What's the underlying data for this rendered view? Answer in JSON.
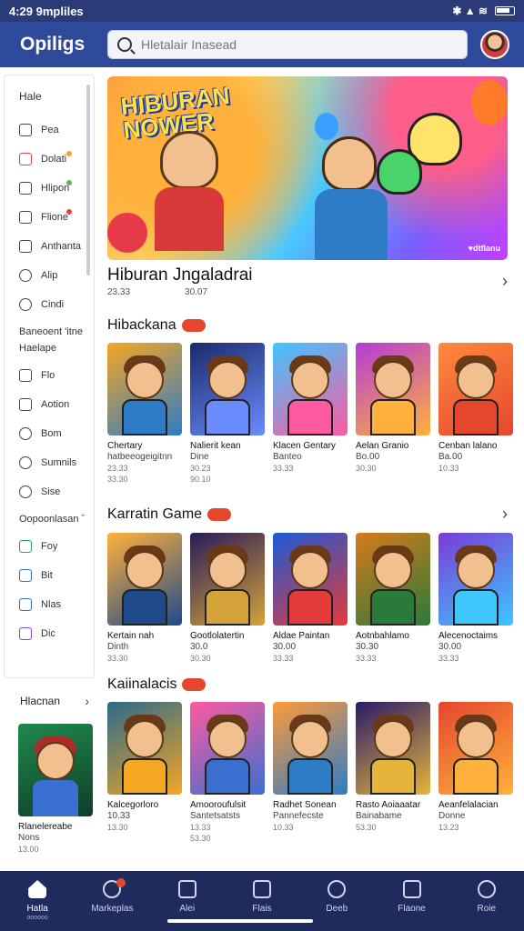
{
  "status": {
    "time": "4:29 9mpliles",
    "icons": "✱ ▲ ≋"
  },
  "header": {
    "title": "Opiligs",
    "search_placeholder": "Hletalair Inasead"
  },
  "sidebar": {
    "heading": "Hale",
    "items_top": [
      {
        "label": "Pea",
        "icon": "store-icon",
        "tone": ""
      },
      {
        "label": "Dolati",
        "icon": "calendar-icon",
        "tone": "red",
        "dot": "#f2a43a"
      },
      {
        "label": "Hlipon",
        "icon": "house-icon",
        "tone": "",
        "dot": "#58b65a"
      },
      {
        "label": "Flione",
        "icon": "book-icon",
        "tone": "",
        "dot": "#e5462e"
      },
      {
        "label": "Anthanta",
        "icon": "bookmark-icon",
        "tone": ""
      },
      {
        "label": "Alip",
        "icon": "gear-icon",
        "tone": "round"
      },
      {
        "label": "Cindi",
        "icon": "clock-icon",
        "tone": "round"
      }
    ],
    "section1": "Baneoent 'itne",
    "section1b": "Haelape",
    "items_mid": [
      {
        "label": "Flo",
        "icon": "pen-icon",
        "tone": ""
      },
      {
        "label": "Aotion",
        "icon": "window-icon",
        "tone": ""
      },
      {
        "label": "Bom",
        "icon": "bell-icon",
        "tone": "round"
      },
      {
        "label": "Sumnils",
        "icon": "globe-icon",
        "tone": "round"
      },
      {
        "label": "Sise",
        "icon": "chat-icon",
        "tone": "round"
      }
    ],
    "section2": "Oopoonlasan ˇ",
    "items_bot": [
      {
        "label": "Foy",
        "icon": "gamepad-icon",
        "tone": "green"
      },
      {
        "label": "Bit",
        "icon": "grid-icon",
        "tone": "blue"
      },
      {
        "label": "Nlas",
        "icon": "pin-icon",
        "tone": "blue"
      },
      {
        "label": "Dic",
        "icon": "doc-icon",
        "tone": "purple"
      }
    ],
    "footer": "Hlacnan"
  },
  "banner": {
    "title_line1": "HIBURAN",
    "title_line2": "NOWER",
    "badge": "♥dtflanu"
  },
  "featured": {
    "title": "Hiburan Jngaladrai",
    "meta1": "23.33",
    "meta2": "30.07"
  },
  "sections": [
    {
      "title": "Hibackana",
      "cards": [
        {
          "title": "Chertary",
          "sub": "hatbeeogeigitnn",
          "price1": "23.33",
          "price2": "33.30"
        },
        {
          "title": "Nalierit kean",
          "sub": "Dine",
          "price1": "30.23",
          "price2": "90.10"
        },
        {
          "title": "Klacen Gentary",
          "sub": "Banteo",
          "price1": "33.33",
          "price2": ""
        },
        {
          "title": "Aelan Granio",
          "sub": "Bo.00",
          "price1": "30.30",
          "price2": ""
        },
        {
          "title": "Cenban lalano",
          "sub": "Ba.00",
          "price1": "10.33",
          "price2": ""
        }
      ]
    },
    {
      "title": "Karratin Game",
      "cards": [
        {
          "title": "Kertain nah",
          "sub": "Dinth",
          "price1": "33.30",
          "price2": ""
        },
        {
          "title": "Gootlolatertin",
          "sub": "30.0",
          "price1": "30.30",
          "price2": ""
        },
        {
          "title": "Aldae Paintan",
          "sub": "30.00",
          "price1": "33.33",
          "price2": ""
        },
        {
          "title": "Aotnbahlamo",
          "sub": "30.30",
          "price1": "33.33",
          "price2": ""
        },
        {
          "title": "Alecenoctaims",
          "sub": "30.00",
          "price1": "33.33",
          "price2": ""
        }
      ]
    },
    {
      "title": "Kaiinalacis",
      "cards": [
        {
          "title": "Kalcegorloro",
          "sub": "10.33",
          "price1": "13.30",
          "price2": ""
        },
        {
          "title": "Amooroufulsit",
          "sub": "Santetsatsts",
          "price1": "13.33",
          "price2": "53.30"
        },
        {
          "title": "Radhet Sonean",
          "sub": "Pannefecste",
          "price1": "10.33",
          "price2": ""
        },
        {
          "title": "Rasto Aoiaaatar",
          "sub": "Bainabame",
          "price1": "53.30",
          "price2": ""
        },
        {
          "title": "Aeanfelalacian",
          "sub": "Donne",
          "price1": "13.23",
          "price2": ""
        }
      ]
    }
  ],
  "left_card": {
    "title": "Rlanelereabe",
    "sub": "Nons",
    "price": "13.00"
  },
  "bottom_nav": [
    {
      "label": "Hatla",
      "sub": "oooooo",
      "icon": "home-icon",
      "active": true
    },
    {
      "label": "Markeplas",
      "icon": "compass-icon",
      "active": false,
      "badge": true
    },
    {
      "label": "Alei",
      "icon": "wand-icon",
      "active": false
    },
    {
      "label": "Flais",
      "icon": "phone-icon",
      "active": false
    },
    {
      "label": "Deeb",
      "icon": "clock-icon",
      "active": false
    },
    {
      "label": "Flaone",
      "icon": "chat-icon",
      "active": false
    },
    {
      "label": "Roie",
      "icon": "search-icon",
      "active": false
    }
  ]
}
